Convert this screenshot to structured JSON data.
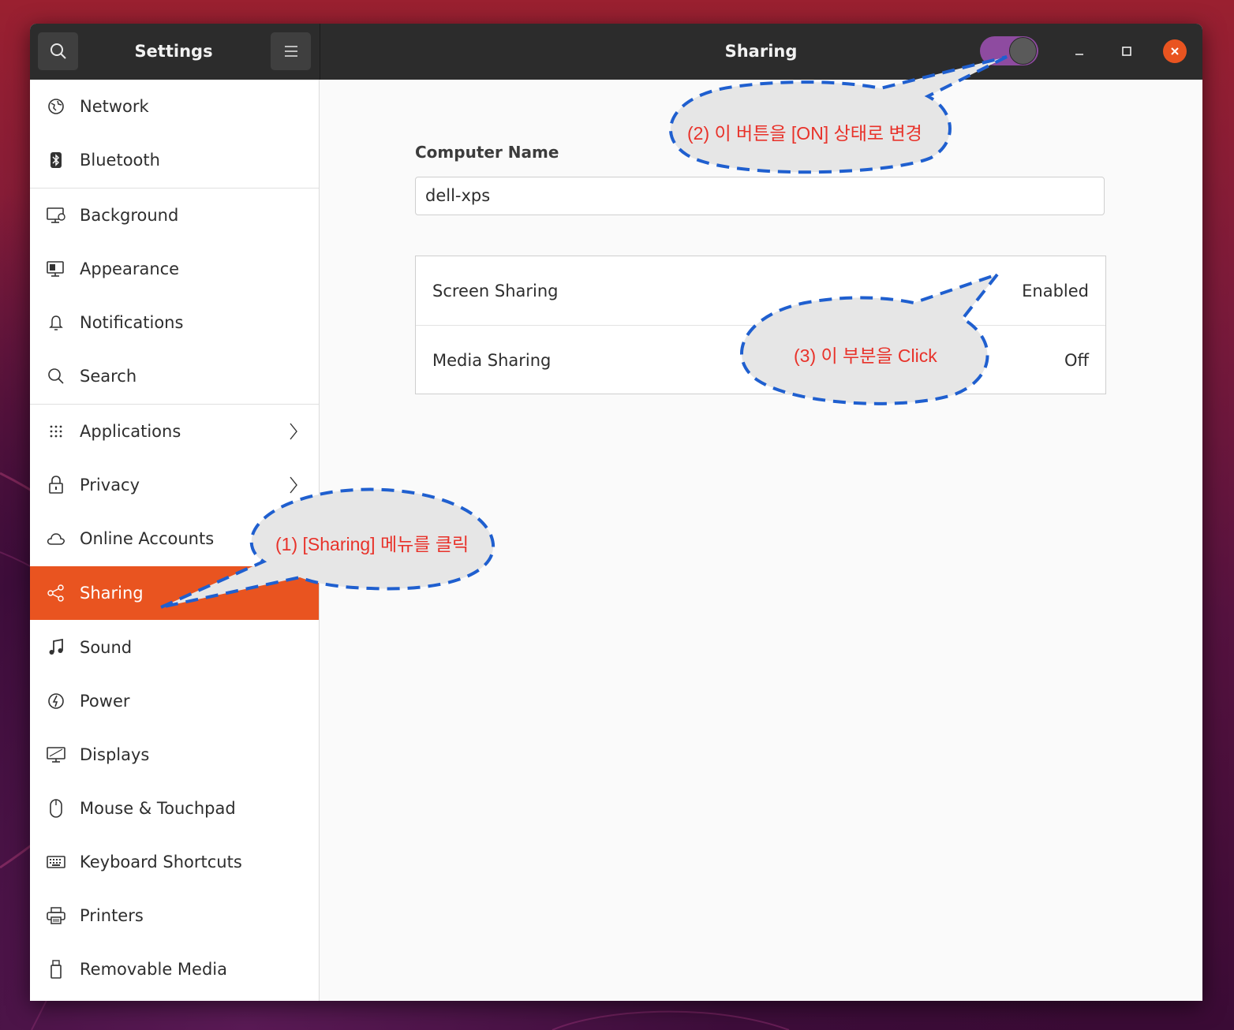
{
  "window": {
    "sidebar_title": "Settings",
    "page_title": "Sharing",
    "sharing_switch": "on"
  },
  "sidebar": {
    "items": [
      {
        "label": "Network",
        "icon": "network-icon"
      },
      {
        "label": "Bluetooth",
        "icon": "bluetooth-icon"
      },
      {
        "label": "Background",
        "icon": "background-icon"
      },
      {
        "label": "Appearance",
        "icon": "appearance-icon"
      },
      {
        "label": "Notifications",
        "icon": "bell-icon"
      },
      {
        "label": "Search",
        "icon": "search-icon"
      },
      {
        "label": "Applications",
        "icon": "apps-grid-icon"
      },
      {
        "label": "Privacy",
        "icon": "lock-icon"
      },
      {
        "label": "Online Accounts",
        "icon": "cloud-icon"
      },
      {
        "label": "Sharing",
        "icon": "share-icon"
      },
      {
        "label": "Sound",
        "icon": "music-note-icon"
      },
      {
        "label": "Power",
        "icon": "power-icon"
      },
      {
        "label": "Displays",
        "icon": "display-icon"
      },
      {
        "label": "Mouse & Touchpad",
        "icon": "mouse-icon"
      },
      {
        "label": "Keyboard Shortcuts",
        "icon": "keyboard-icon"
      },
      {
        "label": "Printers",
        "icon": "printer-icon"
      },
      {
        "label": "Removable Media",
        "icon": "usb-icon"
      }
    ],
    "active": "Sharing"
  },
  "main": {
    "computer_name_label": "Computer Name",
    "computer_name_value": "dell-xps",
    "rows": [
      {
        "label": "Screen Sharing",
        "status": "Enabled"
      },
      {
        "label": "Media Sharing",
        "status": "Off"
      }
    ]
  },
  "annotations": {
    "step1": "(1) [Sharing] 메뉴를 클릭",
    "step2": "(2)  이 버튼을 [ON]  상태로 변경",
    "step3": "(3) 이 부분을 Click"
  },
  "colors": {
    "accent": "#e95420",
    "switch_on": "#8e4ba0",
    "callout_stroke": "#1f5fcf",
    "callout_fill": "#e6e6e6",
    "callout_text": "#e8322a"
  }
}
